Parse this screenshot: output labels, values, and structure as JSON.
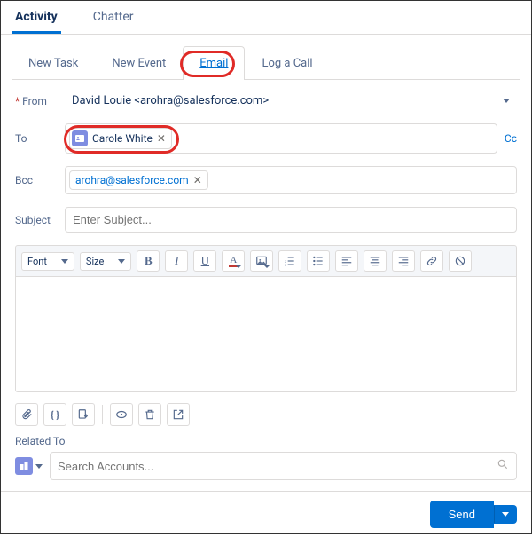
{
  "topTabs": {
    "activity": "Activity",
    "chatter": "Chatter"
  },
  "subTabs": {
    "newTask": "New Task",
    "newEvent": "New Event",
    "email": "Email",
    "logCall": "Log a Call"
  },
  "form": {
    "fromLabel": "From",
    "fromValue": "David Louie <arohra@salesforce.com>",
    "toLabel": "To",
    "toPill": "Carole White",
    "ccLabel": "Cc",
    "bccLabel": "Bcc",
    "bccPill": "arohra@salesforce.com",
    "subjectLabel": "Subject",
    "subjectPlaceholder": "Enter Subject..."
  },
  "editor": {
    "fontLabel": "Font",
    "sizeLabel": "Size"
  },
  "related": {
    "label": "Related To",
    "placeholder": "Search Accounts..."
  },
  "footer": {
    "send": "Send"
  }
}
